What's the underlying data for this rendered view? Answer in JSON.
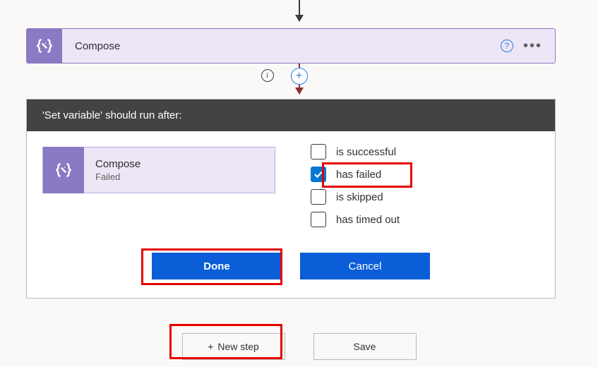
{
  "composeCard": {
    "title": "Compose"
  },
  "panel": {
    "header": "'Set variable' should run after:",
    "prevStep": {
      "name": "Compose",
      "status": "Failed"
    },
    "options": {
      "successful": {
        "label": "is successful",
        "checked": false
      },
      "failed": {
        "label": "has failed",
        "checked": true
      },
      "skipped": {
        "label": "is skipped",
        "checked": false
      },
      "timedout": {
        "label": "has timed out",
        "checked": false
      }
    },
    "buttons": {
      "done": "Done",
      "cancel": "Cancel"
    }
  },
  "bottom": {
    "newStep": "New step",
    "save": "Save"
  }
}
